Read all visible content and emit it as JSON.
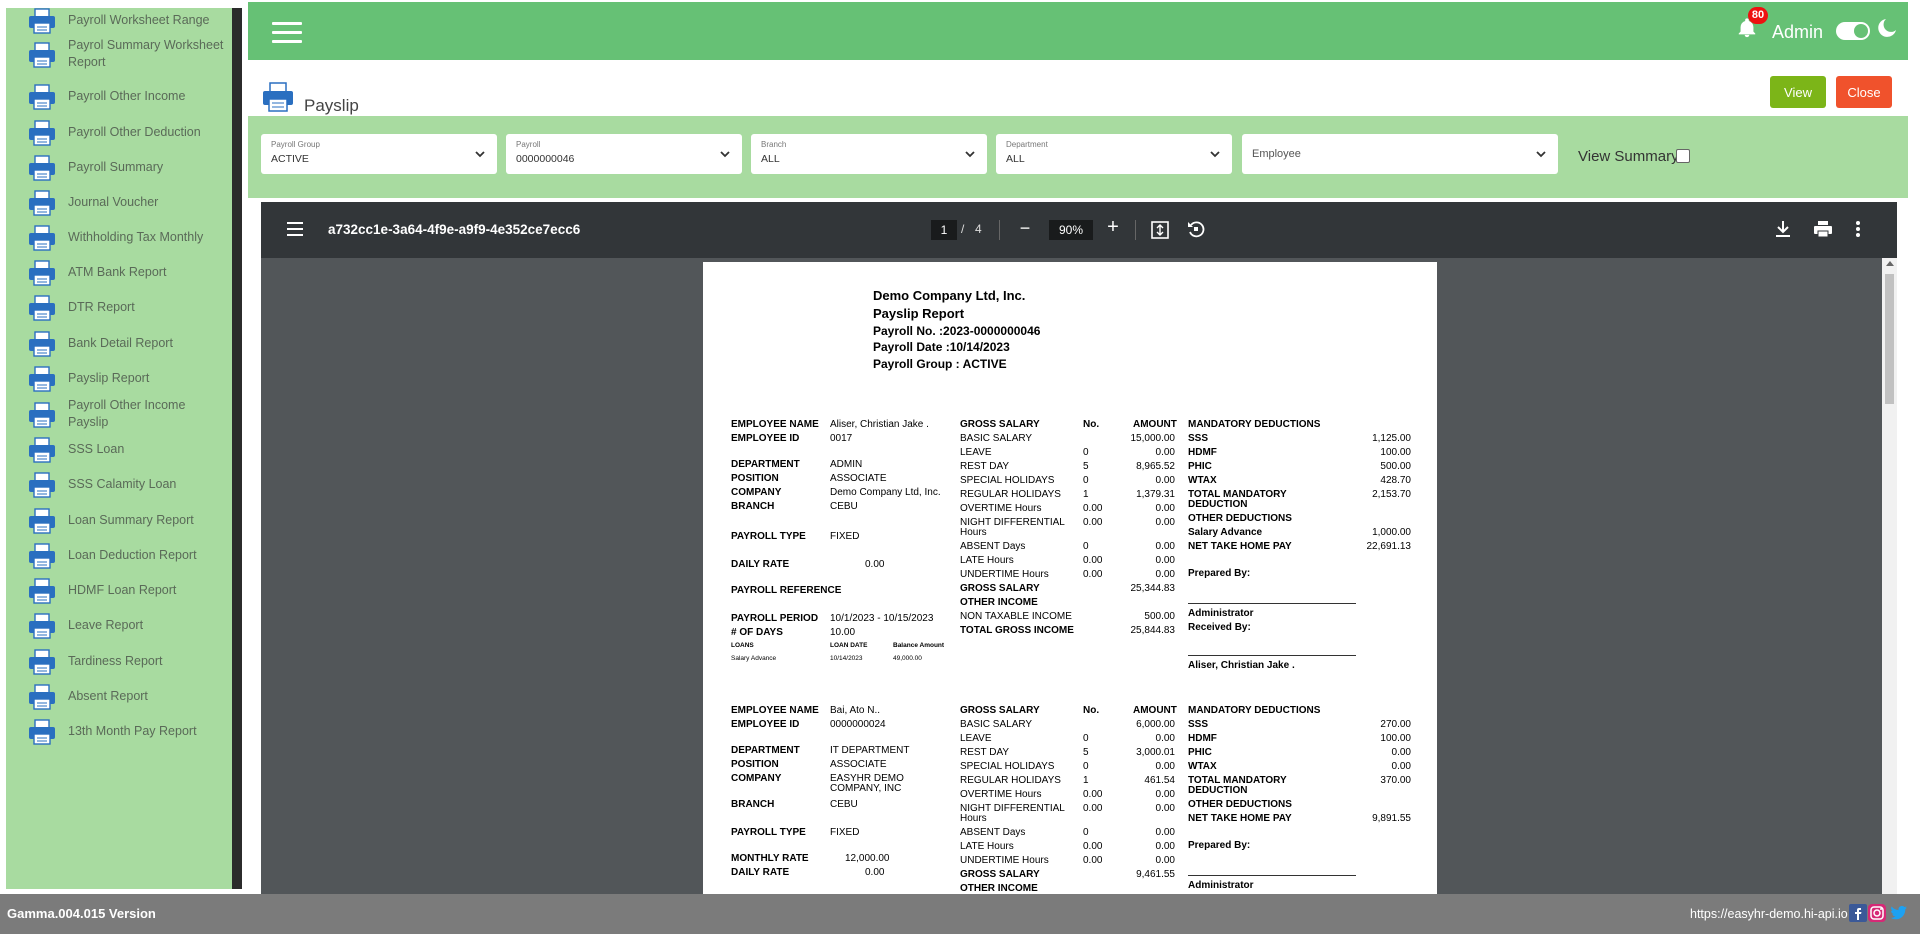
{
  "colors": {
    "primary_green": "#66c175",
    "sidebar_bg": "#a8dba0",
    "view_button": "#7cb518",
    "close_button": "#f0522c",
    "badge_red": "#ee1111"
  },
  "sidebar": {
    "items": [
      {
        "label": "Payroll Worksheet Range",
        "icon": "printer-icon"
      },
      {
        "label": "Payrol Summary Worksheet Report",
        "icon": "printer-icon"
      },
      {
        "label": "Payroll Other Income",
        "icon": "printer-icon"
      },
      {
        "label": "Payroll Other Deduction",
        "icon": "printer-icon"
      },
      {
        "label": "Payroll Summary",
        "icon": "printer-icon"
      },
      {
        "label": "Journal Voucher",
        "icon": "printer-icon"
      },
      {
        "label": "Withholding Tax Monthly",
        "icon": "printer-icon"
      },
      {
        "label": "ATM Bank Report",
        "icon": "printer-icon"
      },
      {
        "label": "DTR Report",
        "icon": "printer-icon"
      },
      {
        "label": "Bank Detail Report",
        "icon": "printer-icon"
      },
      {
        "label": "Payslip Report",
        "icon": "printer-icon"
      },
      {
        "label": "Payroll Other Income Payslip",
        "icon": "printer-icon"
      },
      {
        "label": "SSS Loan",
        "icon": "printer-icon"
      },
      {
        "label": "SSS Calamity Loan",
        "icon": "printer-icon"
      },
      {
        "label": "Loan Summary Report",
        "icon": "printer-icon"
      },
      {
        "label": "Loan Deduction Report",
        "icon": "printer-icon"
      },
      {
        "label": "HDMF Loan Report",
        "icon": "printer-icon"
      },
      {
        "label": "Leave Report",
        "icon": "printer-icon"
      },
      {
        "label": "Tardiness Report",
        "icon": "printer-icon"
      },
      {
        "label": "Absent Report",
        "icon": "printer-icon"
      },
      {
        "label": "13th Month Pay Report",
        "icon": "printer-icon"
      }
    ]
  },
  "topbar": {
    "notification_count": "80",
    "user_name": "Admin"
  },
  "page": {
    "title": "Payslip",
    "view_button": "View",
    "close_button": "Close"
  },
  "filters": {
    "payroll_group": {
      "label": "Payroll Group",
      "value": "ACTIVE"
    },
    "payroll": {
      "label": "Payroll",
      "value": "0000000046"
    },
    "branch": {
      "label": "Branch",
      "value": "ALL"
    },
    "department": {
      "label": "Department",
      "value": "ALL"
    },
    "employee": {
      "placeholder": "Employee"
    },
    "view_summary_label": "View Summary"
  },
  "pdf": {
    "filename": "a732cc1e-3a64-4f9e-a9f9-4e352ce7ecc6",
    "current_page": "1",
    "page_separator": "/",
    "total_pages": "4",
    "zoom": "90%",
    "zoom_out": "−",
    "zoom_in": "+",
    "header": {
      "company": "Demo Company Ltd, Inc.",
      "report_title": "Payslip Report",
      "payroll_no": "Payroll No. :2023-0000000046",
      "payroll_date": "Payroll Date :10/14/2023",
      "payroll_group": "Payroll Group : ACTIVE"
    },
    "labels": {
      "employee_name": "EMPLOYEE NAME",
      "employee_id": "EMPLOYEE ID",
      "department": "DEPARTMENT",
      "position": "POSITION",
      "company": "COMPANY",
      "branch": "BRANCH",
      "payroll_type": "PAYROLL TYPE",
      "daily_rate": "DAILY RATE",
      "monthly_rate": "MONTHLY RATE",
      "payroll_reference": "PAYROLL REFERENCE",
      "payroll_period": "PAYROLL PERIOD",
      "num_days": "# OF DAYS",
      "loans": "LOANS",
      "loan_date": "LOAN DATE",
      "balance_amount": "Balance Amount",
      "gross_salary": "GROSS SALARY",
      "no": "No.",
      "amount": "AMOUNT",
      "basic_salary": "BASIC SALARY",
      "leave": "LEAVE",
      "rest_day": "REST DAY",
      "special_holidays": "SPECIAL HOLIDAYS",
      "regular_holidays": "REGULAR HOLIDAYS",
      "overtime_hours": "OVERTIME Hours",
      "night_differential": "NIGHT DIFFERENTIAL",
      "hours": "Hours",
      "absent_days": "ABSENT Days",
      "late_hours": "LATE Hours",
      "undertime_hours": "UNDERTIME Hours",
      "gross_salary_total": "GROSS  SALARY",
      "other_income": "OTHER INCOME",
      "non_taxable_income": "NON TAXABLE INCOME",
      "total_gross_income": "TOTAL GROSS INCOME",
      "mandatory_deductions": "MANDATORY DEDUCTIONS",
      "sss": "SSS",
      "hdmf": "HDMF",
      "phic": "PHIC",
      "wtax": "WTAX",
      "total_mandatory": "TOTAL MANDATORY",
      "deduction": "DEDUCTION",
      "other_deductions": "OTHER DEDUCTIONS",
      "salary_advance": "Salary Advance",
      "net_take_home_pay": "NET TAKE HOME PAY",
      "prepared_by": "Prepared By:",
      "administrator": "Administrator",
      "received_by": "Received By:"
    },
    "employee1": {
      "name": "Aliser, Christian Jake .",
      "id": "0017",
      "department": "ADMIN",
      "position": "ASSOCIATE",
      "company": "Demo Company Ltd, Inc.",
      "branch": "CEBU",
      "payroll_type": "FIXED",
      "daily_rate": "0.00",
      "payroll_period": "10/1/2023 - 10/15/2023",
      "num_days": "10.00",
      "loan_name": "Salary Advance",
      "loan_date": "10/14/2023",
      "loan_balance": "49,000.00",
      "basic_salary": "15,000.00",
      "leave_no": "0",
      "leave_amt": "0.00",
      "rest_day_no": "5",
      "rest_day_amt": "8,965.52",
      "special_no": "0",
      "special_amt": "0.00",
      "regular_no": "1",
      "regular_amt": "1,379.31",
      "overtime_no": "0.00",
      "overtime_amt": "0.00",
      "night_no": "0.00",
      "night_amt": "0.00",
      "absent_no": "0",
      "absent_amt": "0.00",
      "late_no": "0.00",
      "late_amt": "0.00",
      "undertime_no": "0.00",
      "undertime_amt": "0.00",
      "gross_salary": "25,344.83",
      "non_taxable": "500.00",
      "total_gross": "25,844.83",
      "sss": "1,125.00",
      "hdmf": "100.00",
      "phic": "500.00",
      "wtax": "428.70",
      "total_mandatory": "2,153.70",
      "salary_advance": "1,000.00",
      "net_pay": "22,691.13",
      "received_name": "Aliser, Christian Jake ."
    },
    "employee2": {
      "name": "Bai, Ato N..",
      "id": "0000000024",
      "department": "IT DEPARTMENT",
      "position": "ASSOCIATE",
      "company_line1": "EASYHR DEMO",
      "company_line2": "COMPANY, INC",
      "branch": "CEBU",
      "payroll_type": "FIXED",
      "monthly_rate": "12,000.00",
      "daily_rate": "0.00",
      "basic_salary": "6,000.00",
      "leave_no": "0",
      "leave_amt": "0.00",
      "rest_day_no": "5",
      "rest_day_amt": "3,000.01",
      "special_no": "0",
      "special_amt": "0.00",
      "regular_no": "1",
      "regular_amt": "461.54",
      "overtime_no": "0.00",
      "overtime_amt": "0.00",
      "night_no": "0.00",
      "night_amt": "0.00",
      "absent_no": "0",
      "absent_amt": "0.00",
      "late_no": "0.00",
      "late_amt": "0.00",
      "undertime_no": "0.00",
      "undertime_amt": "0.00",
      "gross_salary": "9,461.55",
      "sss": "270.00",
      "hdmf": "100.00",
      "phic": "0.00",
      "wtax": "0.00",
      "total_mandatory": "370.00",
      "net_pay": "9,891.55"
    }
  },
  "footer": {
    "version": "Gamma.004.015 Version",
    "url": "https://easyhr-demo.hi-api.io"
  }
}
